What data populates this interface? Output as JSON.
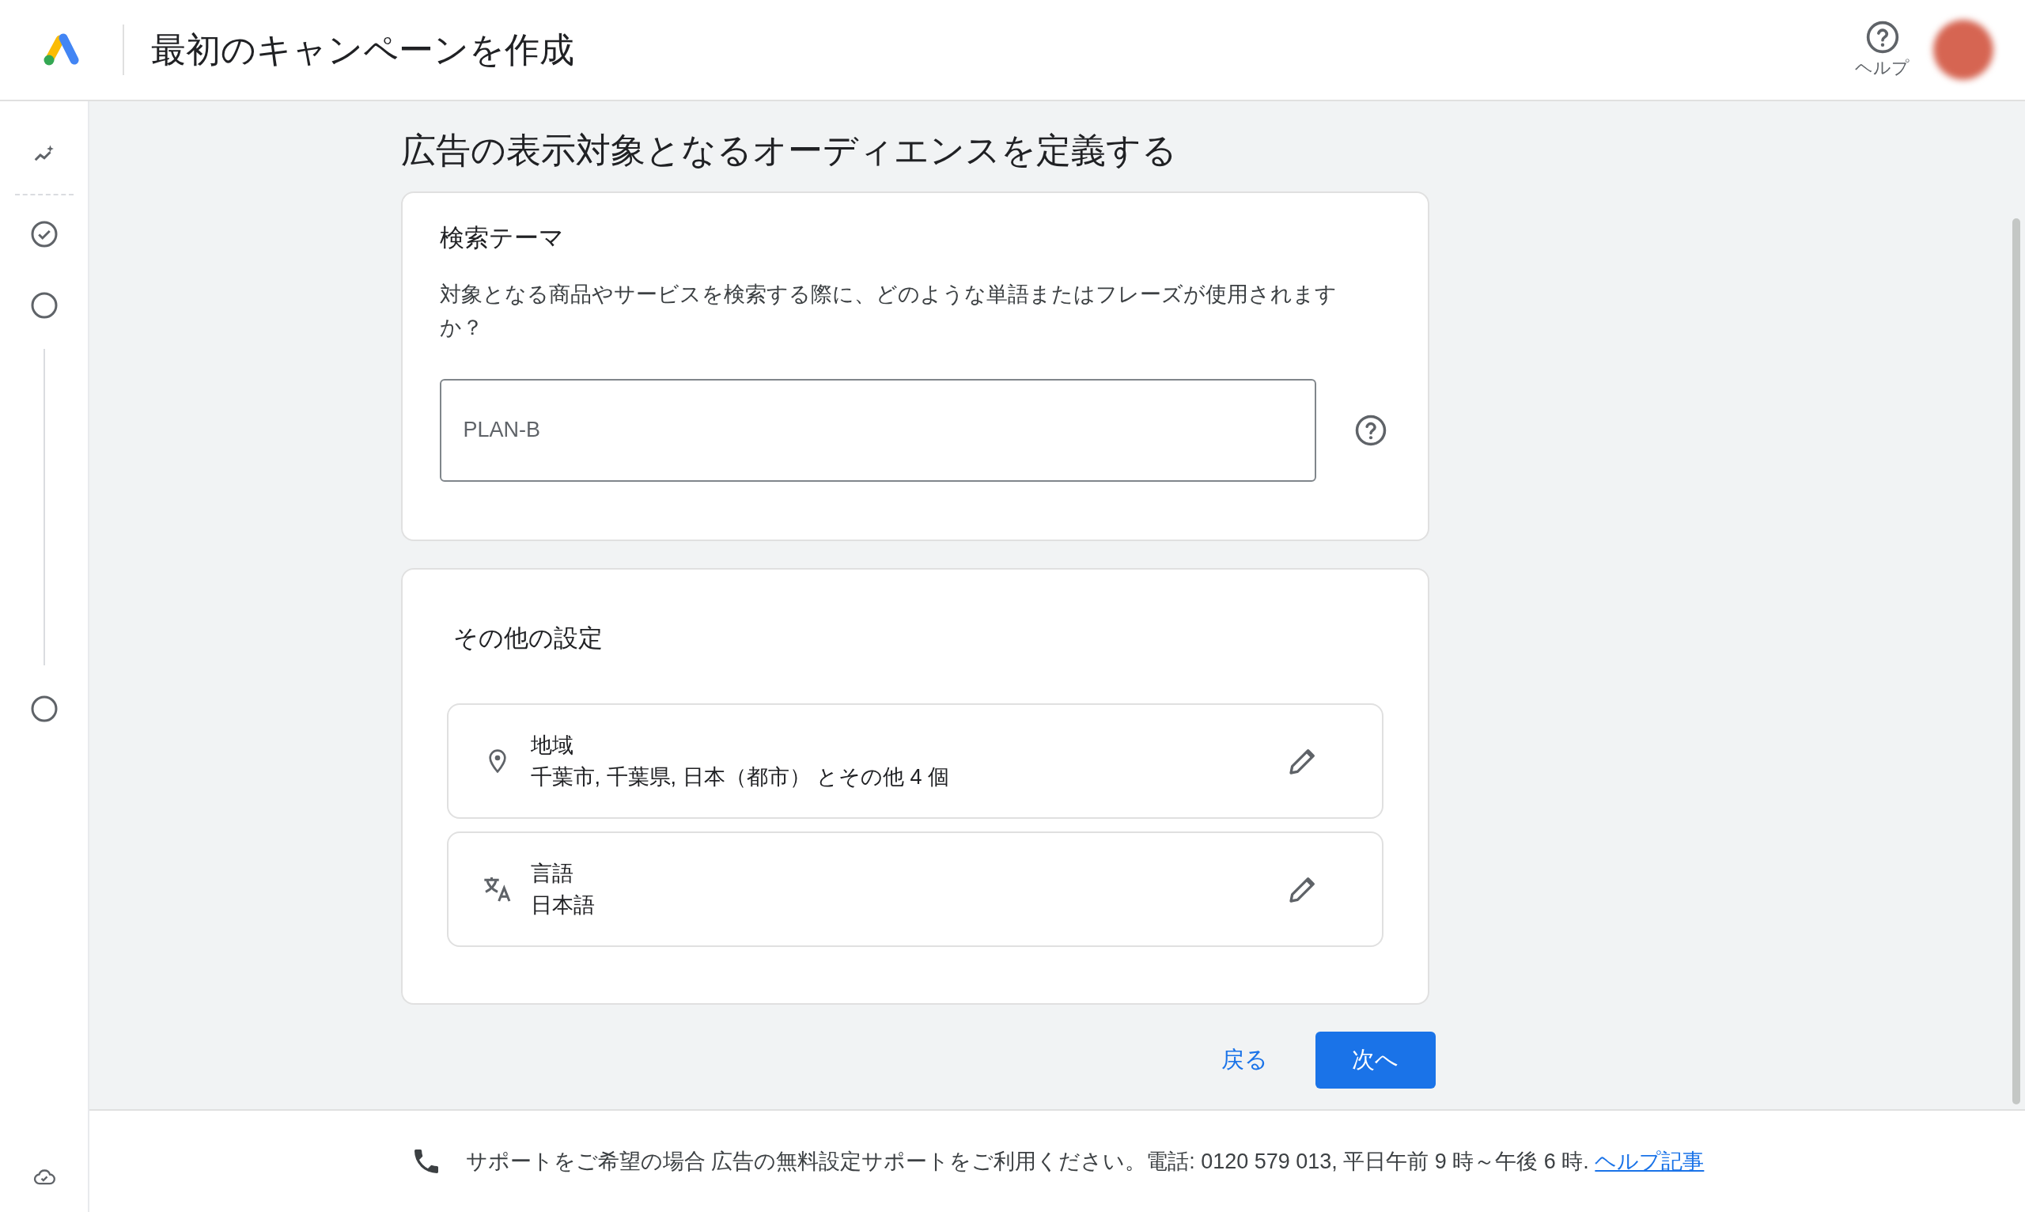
{
  "header": {
    "title": "最初のキャンペーンを作成",
    "help_label": "ヘルプ"
  },
  "steps": [
    {
      "kind": "spark",
      "done": false
    },
    {
      "kind": "step",
      "done": true
    },
    {
      "kind": "step",
      "done": false
    },
    {
      "kind": "step",
      "done": false
    }
  ],
  "page_title": "広告の表示対象となるオーディエンスを定義する",
  "search_theme": {
    "heading": "検索テーマ",
    "question": "対象となる商品やサービスを検索する際に、どのような単語またはフレーズが使用されますか？",
    "value": "PLAN-B"
  },
  "other_settings": {
    "heading": "その他の設定",
    "items": [
      {
        "kind": "location",
        "label": "地域",
        "value": "千葉市, 千葉県, 日本（都市） とその他 4 個"
      },
      {
        "kind": "language",
        "label": "言語",
        "value": "日本語"
      }
    ]
  },
  "buttons": {
    "back": "戻る",
    "next": "次へ"
  },
  "footer": {
    "text": "サポートをご希望の場合 広告の無料設定サポートをご利用ください。電話: 0120 579 013, 平日午前 9 時～午後 6 時.",
    "link": "ヘルプ記事"
  }
}
